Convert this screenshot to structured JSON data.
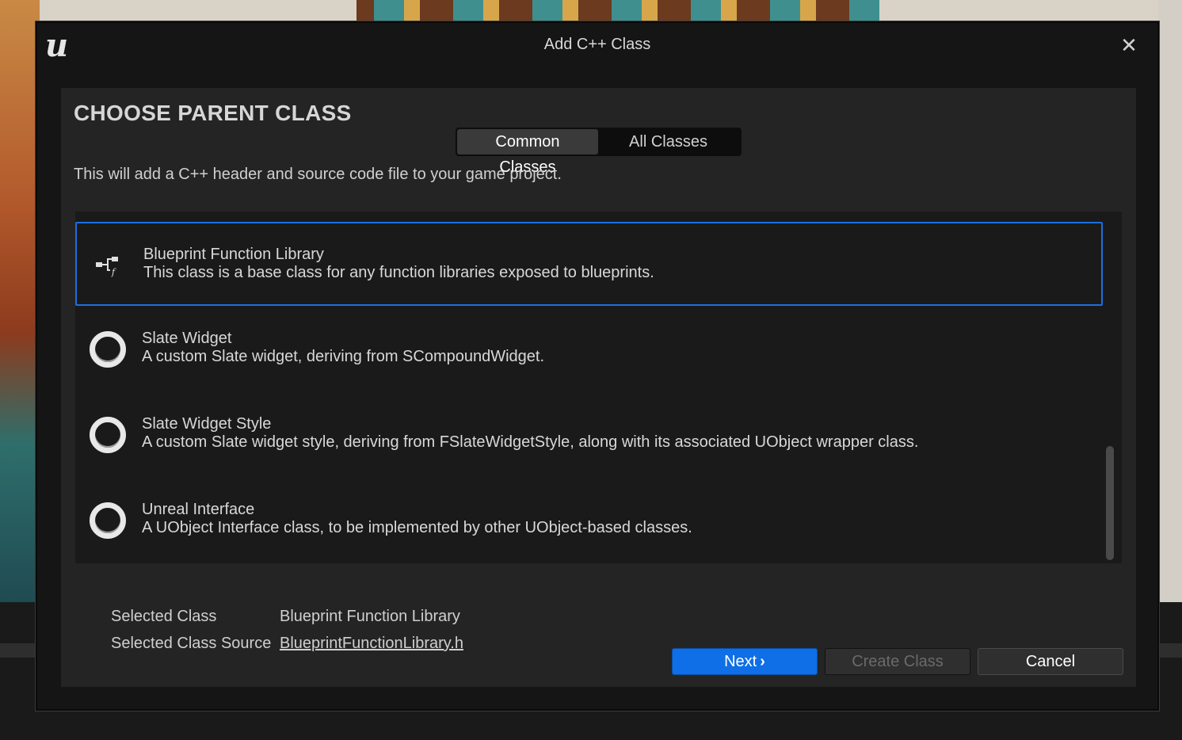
{
  "window": {
    "title": "Add C++ Class",
    "close_glyph": "✕",
    "logo_glyph": "u"
  },
  "panel": {
    "heading": "CHOOSE PARENT CLASS",
    "tabs": [
      {
        "label": "Common Classes",
        "active": true
      },
      {
        "label": "All Classes",
        "active": false
      }
    ],
    "description": "This will add a C++ header and source code file to your game project."
  },
  "classes": [
    {
      "name": "Blueprint Function Library",
      "description": "This class is a base class for any function libraries exposed to blueprints.",
      "icon": "function-library-icon",
      "selected": true
    },
    {
      "name": "Slate Widget",
      "description": "A custom Slate widget, deriving from SCompoundWidget.",
      "icon": "class-ring-icon",
      "selected": false
    },
    {
      "name": "Slate Widget Style",
      "description": "A custom Slate widget style, deriving from FSlateWidgetStyle, along with its associated UObject wrapper class.",
      "icon": "class-ring-icon",
      "selected": false
    },
    {
      "name": "Unreal Interface",
      "description": "A UObject Interface class, to be implemented by other UObject-based classes.",
      "icon": "class-ring-icon",
      "selected": false
    }
  ],
  "selection": {
    "class_label": "Selected Class",
    "class_value": "Blueprint Function Library",
    "source_label": "Selected Class Source",
    "source_value": "BlueprintFunctionLibrary.h"
  },
  "buttons": {
    "next": "Next",
    "next_chevron": "›",
    "create": "Create Class",
    "cancel": "Cancel"
  },
  "colors": {
    "accent": "#0e6fe6",
    "selected_border": "#1c6fe0"
  }
}
